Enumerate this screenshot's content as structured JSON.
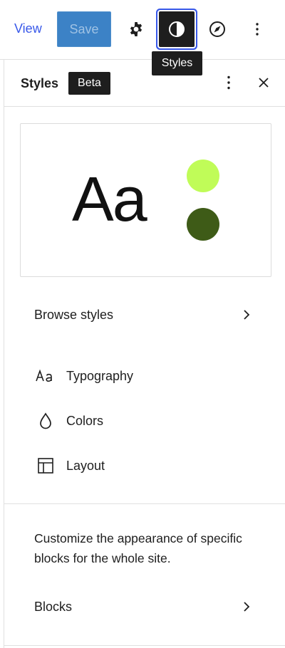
{
  "toolbar": {
    "view_label": "View",
    "save_label": "Save",
    "tooltip": "Styles",
    "icons": [
      "gear-icon",
      "half-circle-contrast-icon",
      "compass-icon",
      "vertical-ellipsis-icon"
    ]
  },
  "panel": {
    "title": "Styles",
    "badge": "Beta",
    "preview": {
      "sample_text": "Aa",
      "swatches": [
        "#c0fc58",
        "#3e5b17"
      ]
    },
    "browse_label": "Browse styles",
    "items": [
      {
        "label": "Typography",
        "icon": "typography-aa-icon"
      },
      {
        "label": "Colors",
        "icon": "droplet-icon"
      },
      {
        "label": "Layout",
        "icon": "layout-icon"
      }
    ],
    "description": "Customize the appearance of specific blocks for the whole site.",
    "blocks_label": "Blocks"
  },
  "colors": {
    "accent": "#3858e9",
    "save_button": "#3c82c6",
    "dark": "#1e1e1e"
  }
}
